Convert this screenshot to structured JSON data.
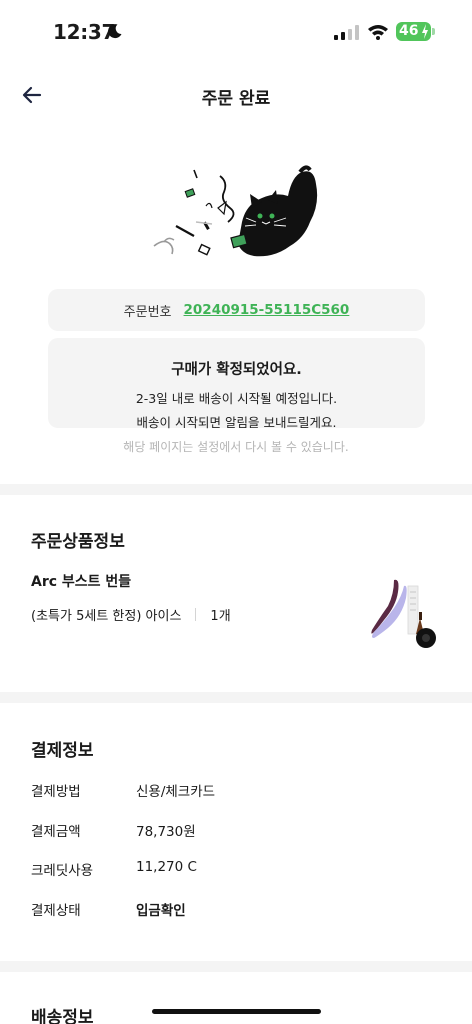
{
  "status": {
    "time": "12:37",
    "battery": "46"
  },
  "nav": {
    "title": "주문 완료"
  },
  "order": {
    "label": "주문번호",
    "number": "20240915-55115C560"
  },
  "confirmation": {
    "title": "구매가 확정되었어요.",
    "line1": "2-3일 내로 배송이 시작될 예정입니다.",
    "line2": "배송이 시작되면 알림을 보내드릴게요."
  },
  "note": "해당 페이지는 설정에서 다시 볼 수 있습니다.",
  "product_section": {
    "title": "주문상품정보",
    "name": "Arc 부스트 번들",
    "option": "(초특가 5세트 한정) 아이스",
    "quantity": "1개"
  },
  "payment_section": {
    "title": "결제정보",
    "rows": [
      {
        "label": "결제방법",
        "value": "신용/체크카드"
      },
      {
        "label": "결제금액",
        "value": "78,730원"
      },
      {
        "label": "크레딧사용",
        "value": "11,270 C"
      },
      {
        "label": "결제상태",
        "value": "입금확인"
      }
    ]
  },
  "shipping_section": {
    "title": "배송정보"
  },
  "colors": {
    "accent_green": "#3fb356",
    "card_bg": "#f4f4f4",
    "battery_green": "#51c55b"
  }
}
